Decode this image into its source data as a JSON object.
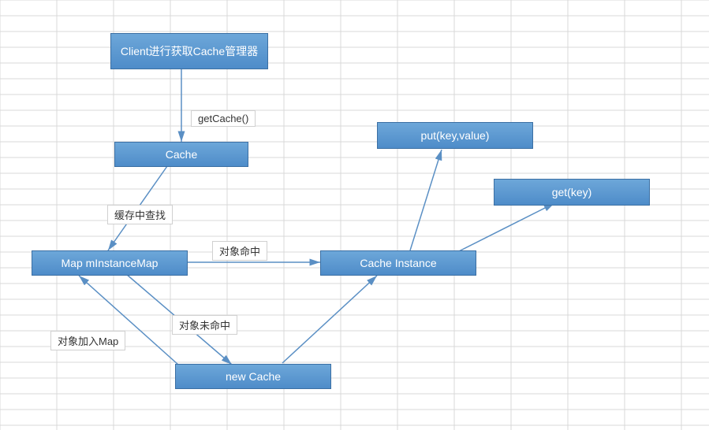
{
  "nodes": {
    "client": "Client进行获取Cache管理器",
    "cache": "Cache",
    "map": "Map mInstanceMap",
    "newCache": "new Cache",
    "cacheInstance": "Cache Instance",
    "put": "put(key,value)",
    "get": "get(key)"
  },
  "edges": {
    "getCache": "getCache()",
    "findInCache": "缓存中查找",
    "objectHit": "对象命中",
    "objectMiss": "对象未命中",
    "addToMap": "对象加入Map"
  }
}
